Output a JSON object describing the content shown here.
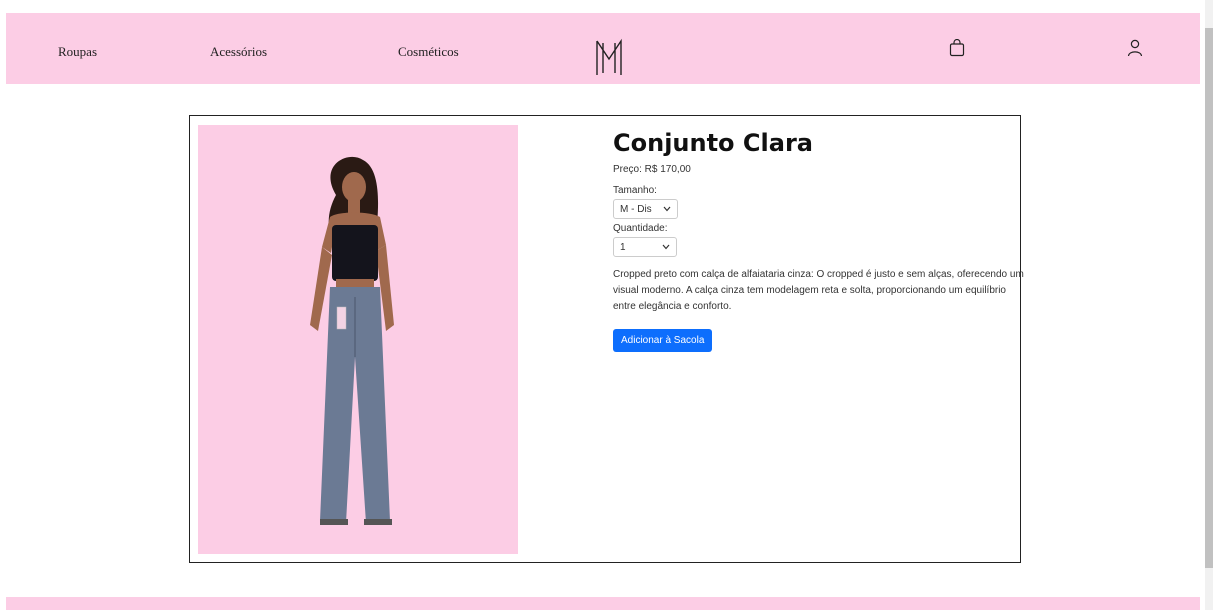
{
  "nav": {
    "links": [
      "Roupas",
      "Acessórios",
      "Cosméticos"
    ],
    "logo_icon": "monogram-m-logo",
    "bag_icon": "shopping-bag-icon",
    "user_icon": "user-icon",
    "background": "#fccde5"
  },
  "product": {
    "title": "Conjunto Clara",
    "price": "Preço: R$ 170,00",
    "size_label": "Tamanho:",
    "size_value": "M - Dis",
    "quantity_label": "Quantidade:",
    "quantity_value": "1",
    "description": "Cropped preto com calça de alfaiataria cinza: O cropped é justo e sem alças, oferecendo um visual moderno. A calça cinza tem modelagem reta e solta, proporcionando um equilíbrio entre elegância e conforto.",
    "add_button": "Adicionar à Sacola",
    "image_background": "#fccde5"
  },
  "colors": {
    "accent": "#0d6efd",
    "brand_pink": "#fccde5"
  }
}
